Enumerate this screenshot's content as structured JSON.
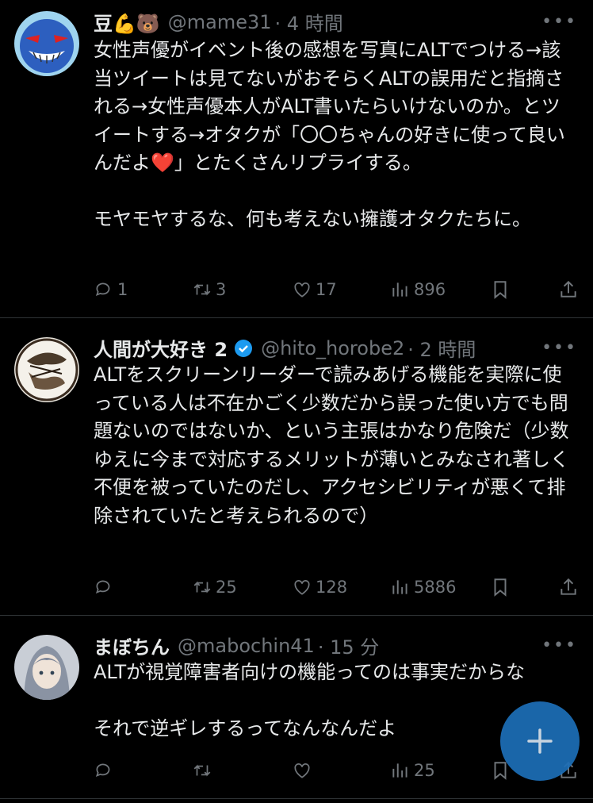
{
  "tweets": [
    {
      "name": "豆💪🐻",
      "handle": "@mame31",
      "time": "· 4 時間",
      "body": "女性声優がイベント後の感想を写真にALTでつける→該当ツイートは見てないがおそらくALTの誤用だと指摘される→女性声優本人がALT書いたらいけないのか。とツイートする→オタクが「〇〇ちゃんの好きに使って良いんだよ❤️」とたくさんリプライする。\n\nモヤモヤするな、何も考えない擁護オタクたちに。",
      "replies": "1",
      "retweets": "3",
      "likes": "17",
      "views": "896"
    },
    {
      "name": "人間が大好き 2",
      "handle": "@hito_horobe2",
      "time": "· 2 時間",
      "body": "ALTをスクリーンリーダーで読みあげる機能を実際に使っている人は不在かごく少数だから誤った使い方でも問題ないのではないか、という主張はかなり危険だ（少数ゆえに今まで対応するメリットが薄いとみなされ著しく不便を被っていたのだし、アクセシビリティが悪くて排除されていたと考えられるので）",
      "replies": "",
      "retweets": "25",
      "likes": "128",
      "views": "5886"
    },
    {
      "name": "まぼちん",
      "handle": "@mabochin41",
      "time": "· 15 分",
      "body": "ALTが視覚障害者向けの機能ってのは事実だからな\n\nそれで逆ギレするってなんなんだよ",
      "replies": "",
      "retweets": "",
      "likes": "",
      "views": "25"
    }
  ],
  "colors": {
    "text": "#e7e9ea",
    "muted": "#71767b",
    "accent": "#1d9bf0",
    "fab": "#1d6fb8",
    "divider": "#2f3336"
  },
  "icons": [
    "reply-icon",
    "retweet-icon",
    "like-icon",
    "views-icon",
    "bookmark-icon",
    "share-icon",
    "more-icon",
    "verified-icon",
    "compose-icon"
  ]
}
